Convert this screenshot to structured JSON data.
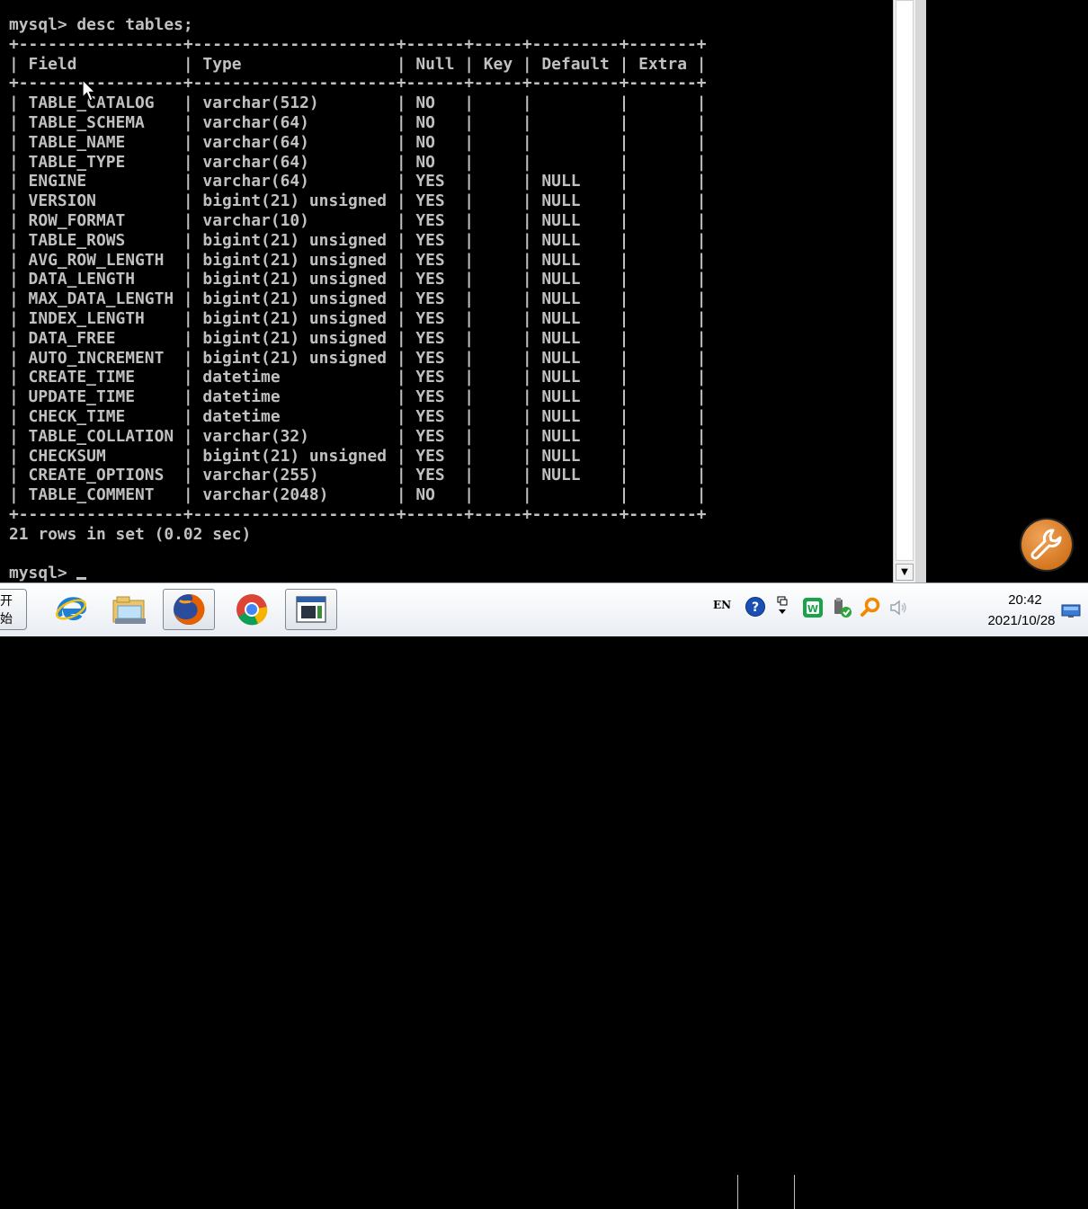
{
  "console": {
    "command": "mysql> desc tables;",
    "border": "+-----------------+---------------------+------+-----+---------+-------+",
    "header": "| Field           | Type                | Null | Key | Default | Extra |",
    "rows": [
      "| TABLE_CATALOG   | varchar(512)        | NO   |     |         |       |",
      "| TABLE_SCHEMA    | varchar(64)         | NO   |     |         |       |",
      "| TABLE_NAME      | varchar(64)         | NO   |     |         |       |",
      "| TABLE_TYPE      | varchar(64)         | NO   |     |         |       |",
      "| ENGINE          | varchar(64)         | YES  |     | NULL    |       |",
      "| VERSION         | bigint(21) unsigned | YES  |     | NULL    |       |",
      "| ROW_FORMAT      | varchar(10)         | YES  |     | NULL    |       |",
      "| TABLE_ROWS      | bigint(21) unsigned | YES  |     | NULL    |       |",
      "| AVG_ROW_LENGTH  | bigint(21) unsigned | YES  |     | NULL    |       |",
      "| DATA_LENGTH     | bigint(21) unsigned | YES  |     | NULL    |       |",
      "| MAX_DATA_LENGTH | bigint(21) unsigned | YES  |     | NULL    |       |",
      "| INDEX_LENGTH    | bigint(21) unsigned | YES  |     | NULL    |       |",
      "| DATA_FREE       | bigint(21) unsigned | YES  |     | NULL    |       |",
      "| AUTO_INCREMENT  | bigint(21) unsigned | YES  |     | NULL    |       |",
      "| CREATE_TIME     | datetime            | YES  |     | NULL    |       |",
      "| UPDATE_TIME     | datetime            | YES  |     | NULL    |       |",
      "| CHECK_TIME      | datetime            | YES  |     | NULL    |       |",
      "| TABLE_COLLATION | varchar(32)         | YES  |     | NULL    |       |",
      "| CHECKSUM        | bigint(21) unsigned | YES  |     | NULL    |       |",
      "| CREATE_OPTIONS  | varchar(255)        | YES  |     | NULL    |       |",
      "| TABLE_COMMENT   | varchar(2048)       | NO   |     |         |       |"
    ],
    "result": "21 rows in set (0.02 sec)",
    "prompt": "mysql> "
  },
  "taskbar": {
    "start_label": "开始",
    "apps": [
      {
        "icon": "internet-explorer-icon"
      },
      {
        "icon": "file-explorer-icon"
      },
      {
        "icon": "firefox-icon"
      },
      {
        "icon": "chrome-icon"
      },
      {
        "icon": "command-prompt-icon"
      }
    ],
    "tray": {
      "language": "EN",
      "time": "20:42",
      "date": "2021/10/28"
    }
  },
  "colors": {
    "console_text": "#c0c0c0",
    "console_bg": "#000000",
    "tool_button": "#e07b20"
  }
}
